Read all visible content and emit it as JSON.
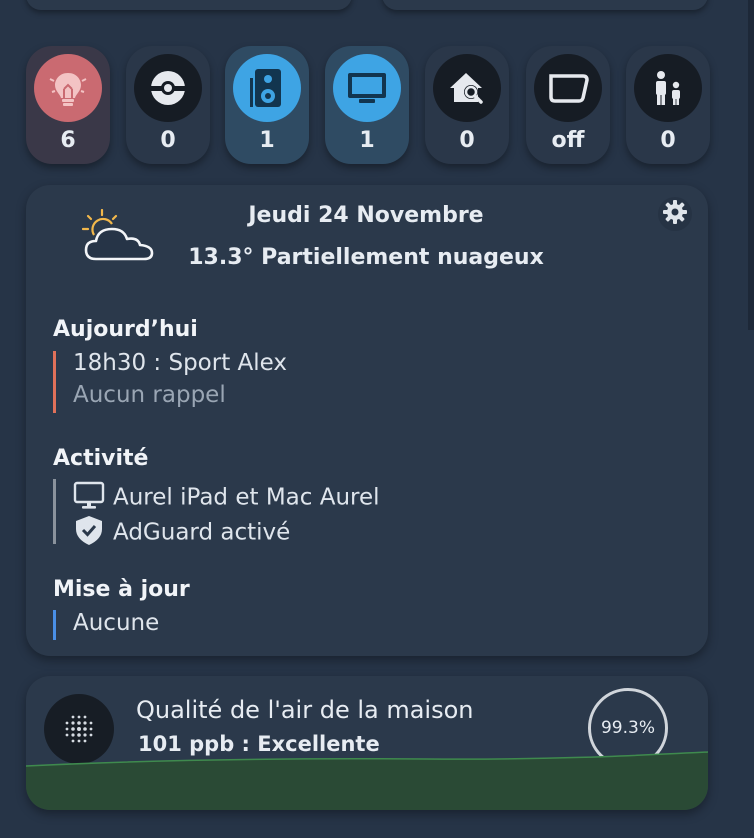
{
  "chips": [
    {
      "name": "lights",
      "icon": "lightbulb-icon",
      "count": "6",
      "state": "light-on"
    },
    {
      "name": "robot-vacuum",
      "icon": "pokeball-icon",
      "count": "0",
      "state": "idle"
    },
    {
      "name": "speakers",
      "icon": "speaker-icon",
      "count": "1",
      "state": "active"
    },
    {
      "name": "screens",
      "icon": "monitor-icon",
      "count": "1",
      "state": "active"
    },
    {
      "name": "home-search",
      "icon": "home-search-icon",
      "count": "0",
      "state": "idle"
    },
    {
      "name": "mirror",
      "icon": "mirror-icon",
      "count": "off",
      "state": "idle"
    },
    {
      "name": "people",
      "icon": "people-icon",
      "count": "0",
      "state": "idle"
    }
  ],
  "weather": {
    "date": "Jeudi 24 Novembre",
    "summary": "13.3° Partiellement nuageux",
    "icon": "partly-cloudy-icon"
  },
  "today": {
    "title": "Aujourd’hui",
    "event": "18h30 : Sport Alex",
    "reminder": "Aucun rappel",
    "accent": "#e0715a"
  },
  "activity": {
    "title": "Activité",
    "devices": "Aurel iPad et Mac Aurel",
    "adguard": "AdGuard activé",
    "accent": "#8a929c"
  },
  "updates": {
    "title": "Mise à jour",
    "value": "Aucune",
    "accent": "#4a8fe6"
  },
  "air": {
    "title": "Qualité de l'air de la maison",
    "value": "101 ppb : Excellente",
    "percent": "99.3%",
    "graph_color": "#2f5a3a"
  },
  "colors": {
    "background": "#263447",
    "card": "#2b394b",
    "light_on": "#ca6a71",
    "active_blue": "#3ea4e4"
  }
}
